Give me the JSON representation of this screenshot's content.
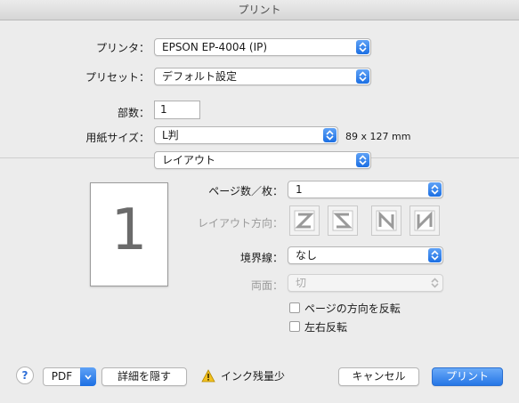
{
  "window": {
    "title": "プリント"
  },
  "printer": {
    "label": "プリンタ：",
    "value": "EPSON EP-4004 (IP)"
  },
  "preset": {
    "label": "プリセット：",
    "value": "デフォルト設定"
  },
  "copies": {
    "label": "部数：",
    "value": "1"
  },
  "paper": {
    "label": "用紙サイズ：",
    "value": "L判",
    "dimensions": "89 x 127 mm"
  },
  "panel": {
    "value": "レイアウト"
  },
  "preview": {
    "page_number": "1"
  },
  "layout": {
    "pages_per_sheet_label": "ページ数／枚：",
    "pages_per_sheet_value": "1",
    "direction_label": "レイアウト方向：",
    "border_label": "境界線：",
    "border_value": "なし",
    "two_sided_label": "両面：",
    "two_sided_value": "切",
    "reverse_orientation_label": "ページの方向を反転",
    "flip_horizontal_label": "左右反転"
  },
  "footer": {
    "help_label": "?",
    "pdf_label": "PDF",
    "hide_details_label": "詳細を隠す",
    "ink_warning": "インク残量少",
    "cancel_label": "キャンセル",
    "print_label": "プリント"
  },
  "colors": {
    "accent": "#2576e6",
    "background": "#ececec"
  },
  "icons": {
    "arrows": "chevron-up-down-icon",
    "warning": "warning-icon",
    "directions": [
      "layout-z-icon",
      "layout-s-icon",
      "layout-n-icon",
      "layout-reverse-n-icon"
    ]
  }
}
